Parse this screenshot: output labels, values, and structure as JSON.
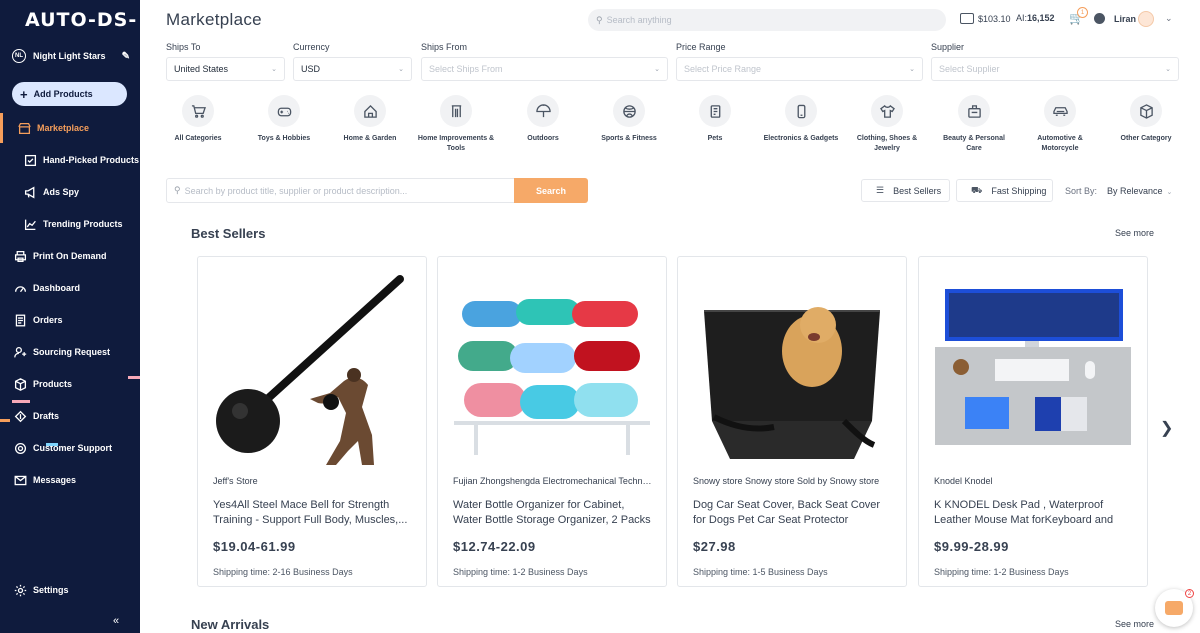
{
  "brand": {
    "logo": "AUTO-DS-"
  },
  "sidebar": {
    "store_initials": "NL",
    "store_name": "Night Light Stars",
    "add_products": "Add Products",
    "items": [
      {
        "label": "Marketplace",
        "icon": "shop-icon",
        "active": true
      },
      {
        "label": "Hand-Picked Products",
        "icon": "hand-picked-icon"
      },
      {
        "label": "Ads Spy",
        "icon": "megaphone-icon"
      },
      {
        "label": "Trending Products",
        "icon": "trending-icon"
      },
      {
        "label": "Print On Demand",
        "icon": "print-icon"
      },
      {
        "label": "Dashboard",
        "icon": "dashboard-icon"
      },
      {
        "label": "Orders",
        "icon": "orders-icon"
      },
      {
        "label": "Sourcing Request",
        "icon": "sourcing-icon"
      },
      {
        "label": "Products",
        "icon": "box-icon"
      },
      {
        "label": "Drafts",
        "icon": "drafts-icon"
      },
      {
        "label": "Customer Support",
        "icon": "support-icon"
      },
      {
        "label": "Messages",
        "icon": "mail-icon"
      }
    ],
    "settings": "Settings",
    "collapse": "«"
  },
  "header": {
    "title": "Marketplace",
    "search_placeholder": "Search anything",
    "balance": "$103.10",
    "ai_label": "AI:",
    "ai_value": "16,152",
    "notif_count": "1",
    "user": "Liran"
  },
  "filters": [
    {
      "label": "Ships To",
      "value": "United States",
      "placeholder": false
    },
    {
      "label": "Currency",
      "value": "USD",
      "placeholder": false
    },
    {
      "label": "Ships From",
      "value": "Select Ships From",
      "placeholder": true
    },
    {
      "label": "Price Range",
      "value": "Select Price Range",
      "placeholder": true
    },
    {
      "label": "Supplier",
      "value": "Select Supplier",
      "placeholder": true
    }
  ],
  "categories": [
    {
      "label": "All Categories",
      "icon": "cart-icon"
    },
    {
      "label": "Toys & Hobbies",
      "icon": "gamepad-icon"
    },
    {
      "label": "Home & Garden",
      "icon": "house-icon"
    },
    {
      "label": "Home Improvements & Tools",
      "icon": "tools-icon"
    },
    {
      "label": "Outdoors",
      "icon": "umbrella-icon"
    },
    {
      "label": "Sports & Fitness",
      "icon": "ball-icon"
    },
    {
      "label": "Pets",
      "icon": "pet-icon"
    },
    {
      "label": "Electronics & Gadgets",
      "icon": "phone-icon"
    },
    {
      "label": "Clothing, Shoes & Jewelry",
      "icon": "shirt-icon"
    },
    {
      "label": "Beauty & Personal Care",
      "icon": "beauty-icon"
    },
    {
      "label": "Automotive & Motorcycle",
      "icon": "car-icon"
    },
    {
      "label": "Other Category",
      "icon": "cube-icon"
    }
  ],
  "search": {
    "placeholder": "Search by product title, supplier or product description...",
    "button": "Search"
  },
  "toolbar": {
    "best_sellers": "Best Sellers",
    "fast_shipping": "Fast Shipping",
    "sort_label": "Sort By:",
    "sort_value": "By Relevance"
  },
  "sections": {
    "best_sellers": "Best Sellers",
    "new_arrivals": "New Arrivals",
    "see_more": "See more"
  },
  "products": [
    {
      "seller": "Jeff's Store",
      "title": "Yes4All Steel Mace Bell for Strength Training - Support Full Body, Muscles,...",
      "price": "$19.04-61.99",
      "shipping": "Shipping time: 2-16 Business Days",
      "image": "mace-icon"
    },
    {
      "seller": "Fujian Zhongshengda Electromechanical Technology",
      "title": "Water Bottle Organizer for Cabinet, Water Bottle Storage Organizer, 2 Packs Water...",
      "price": "$12.74-22.09",
      "shipping": "Shipping time: 1-2 Business Days",
      "image": "bottle-rack-icon"
    },
    {
      "seller": "Snowy store Snowy store Sold by Snowy store",
      "title": "Dog Car Seat Cover, Back Seat Cover for Dogs Pet Car Seat Protector Waterproof...",
      "price": "$27.98",
      "shipping": "Shipping time: 1-5 Business Days",
      "image": "seat-cover-icon"
    },
    {
      "seller": "Knodel Knodel",
      "title": "K KNODEL Desk Pad , Waterproof Leather Mouse Mat forKeyboard and Mouse,...",
      "price": "$9.99-28.99",
      "shipping": "Shipping time: 1-2 Business Days",
      "image": "desk-pad-icon"
    }
  ],
  "chat": {
    "badge": "2"
  },
  "colors": {
    "sidebar": "#0f1b3d",
    "accent": "#f59e5b",
    "search_button": "#f6a968"
  }
}
